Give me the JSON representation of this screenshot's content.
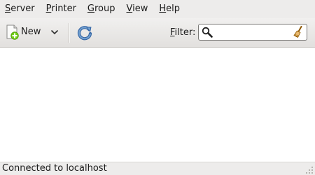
{
  "menubar": {
    "items": [
      {
        "mnemonic": "S",
        "rest": "erver"
      },
      {
        "mnemonic": "P",
        "rest": "rinter"
      },
      {
        "mnemonic": "G",
        "rest": "roup"
      },
      {
        "mnemonic": "V",
        "rest": "iew"
      },
      {
        "mnemonic": "H",
        "rest": "elp"
      }
    ]
  },
  "toolbar": {
    "new_label": "New",
    "new_icon": "new-printer-icon",
    "dropdown_icon": "chevron-down-icon",
    "refresh_icon": "refresh-icon",
    "filter": {
      "mnemonic": "F",
      "rest": "ilter:",
      "value": "",
      "search_icon": "search-icon",
      "clear_icon": "clear-broom-icon"
    }
  },
  "statusbar": {
    "text": "Connected to localhost"
  },
  "colors": {
    "window_bg": "#edeceb",
    "content_bg": "#ffffff",
    "refresh_blue": "#3465a4",
    "add_green": "#4e9a06"
  }
}
